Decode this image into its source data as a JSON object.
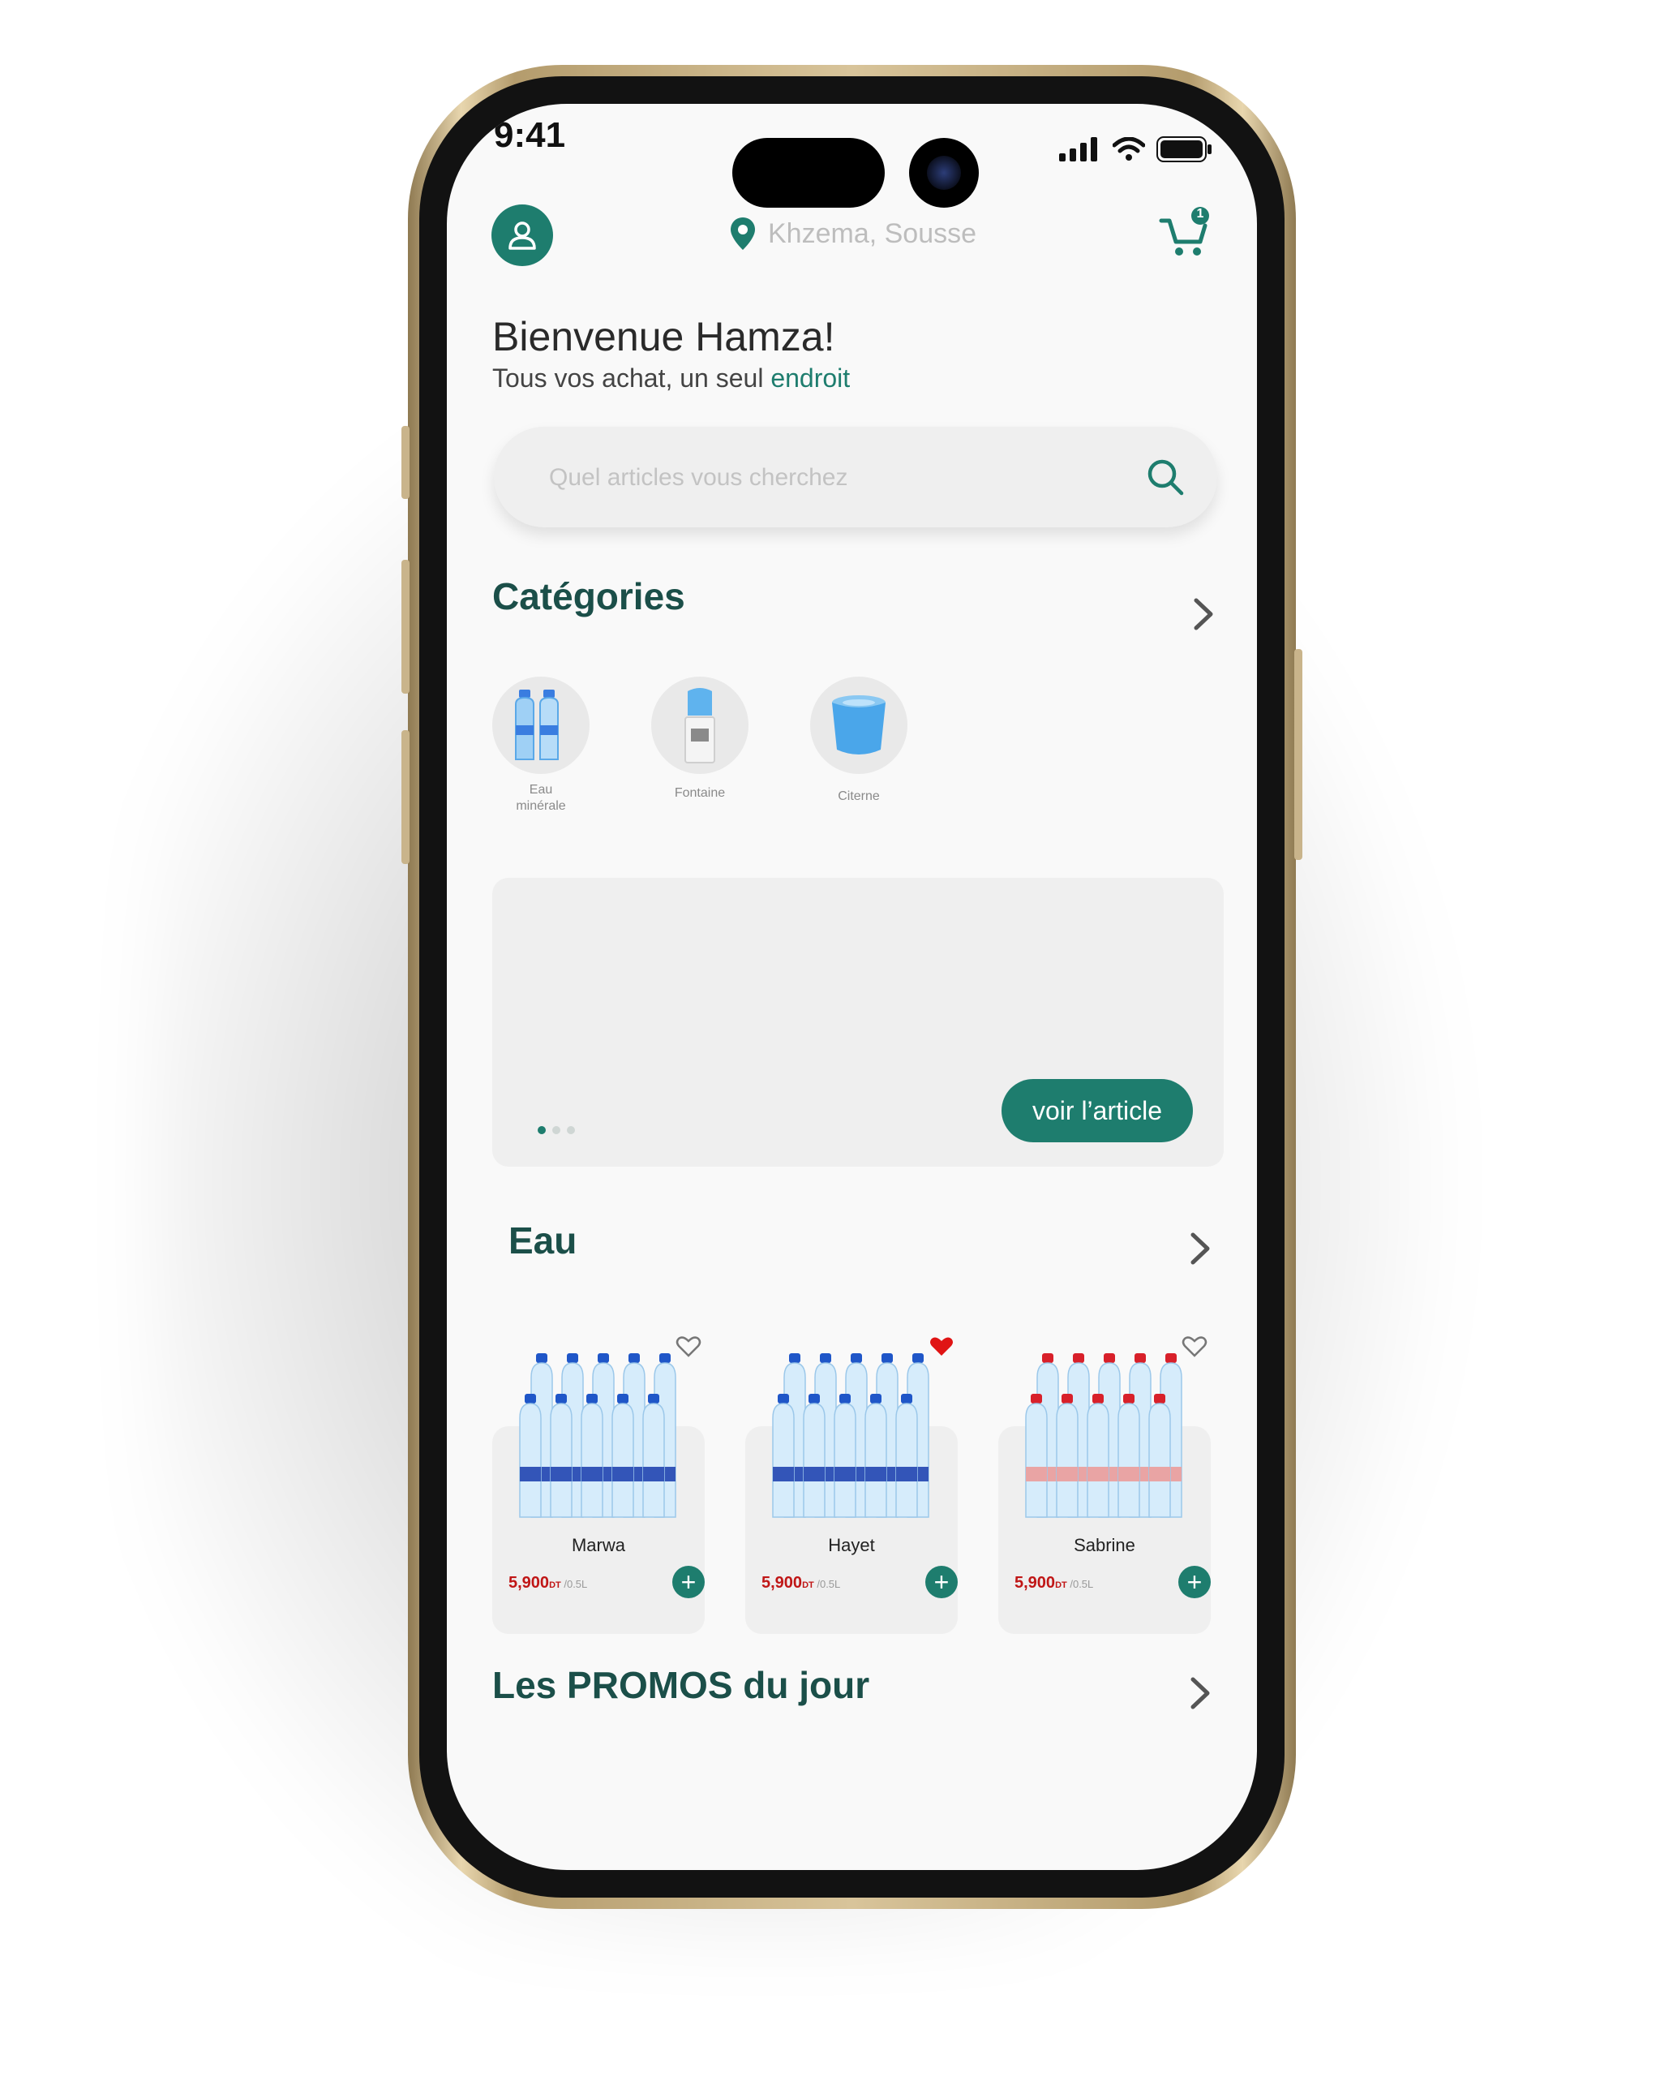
{
  "status_bar": {
    "time": "9:41"
  },
  "header": {
    "location": "Khzema, Sousse",
    "cart_badge": "1"
  },
  "greeting": {
    "title": "Bienvenue Hamza!",
    "tagline_prefix": "Tous vos achat, un seul ",
    "tagline_highlight": "endroit"
  },
  "search": {
    "placeholder": "Quel articles vous cherchez"
  },
  "categories": {
    "title": "Catégories",
    "items": [
      {
        "label": "Eau minérale",
        "icon": "water-bottles-icon"
      },
      {
        "label": "Fontaine",
        "icon": "water-fountain-icon"
      },
      {
        "label": "Citerne",
        "icon": "water-tank-icon"
      }
    ]
  },
  "banner": {
    "button_label": "voir l’article",
    "pages": 3,
    "active_page": 1
  },
  "eau": {
    "title": "Eau",
    "products": [
      {
        "name": "Marwa",
        "price": "5,900",
        "currency": "DT",
        "unit": "/0.5L",
        "favorite": false,
        "cap_color": "#1f56c8"
      },
      {
        "name": "Hayet",
        "price": "5,900",
        "currency": "DT",
        "unit": "/0.5L",
        "favorite": true,
        "cap_color": "#1f56c8"
      },
      {
        "name": "Sabrine",
        "price": "5,900",
        "currency": "DT",
        "unit": "/0.5L",
        "favorite": false,
        "cap_color": "#d8202a"
      }
    ]
  },
  "promos": {
    "title": "Les PROMOS du jour"
  },
  "colors": {
    "accent": "#1e7d6e",
    "heading": "#1b4f49",
    "price": "#c01616",
    "favorite": "#e01414"
  }
}
